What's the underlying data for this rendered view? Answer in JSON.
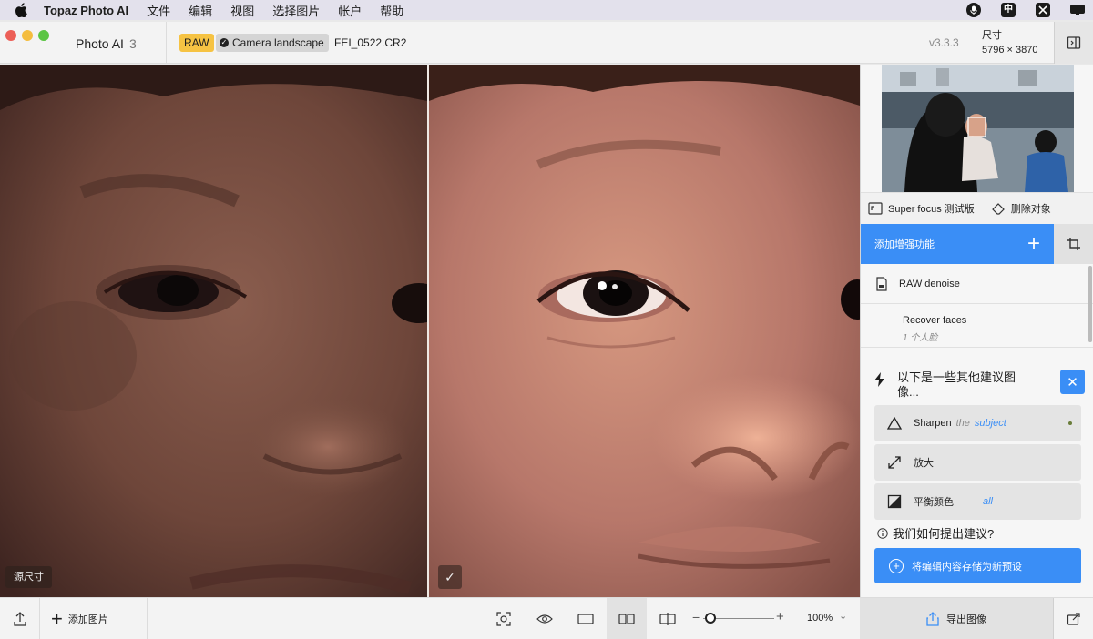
{
  "menubar": {
    "app_name": "Topaz Photo AI",
    "items": [
      "文件",
      "编辑",
      "视图",
      "选择图片",
      "帐户",
      "帮助"
    ],
    "tray_icons": [
      "microphone-icon",
      "input-method-icon",
      "capcut-icon",
      "display-icon"
    ],
    "input_method_label": "中"
  },
  "titlebar": {
    "app_title": "Photo AI",
    "app_version_number": "3",
    "raw_badge": "RAW",
    "preset_badge": "Camera landscape",
    "filename": "FEI_0522.CR2",
    "version": "v3.3.3",
    "size_label": "尺寸",
    "size_value": "5796 × 3870"
  },
  "viewer": {
    "source_label": "源尺寸",
    "check_label": "✓"
  },
  "panel": {
    "tools": [
      {
        "label": "Super focus 测试版",
        "icon": "focus-frame-icon"
      },
      {
        "label": "删除对象",
        "icon": "eraser-icon"
      }
    ],
    "add_enhancement": "添加增强功能",
    "features": [
      {
        "name": "RAW denoise",
        "icon": "raw-file-icon"
      },
      {
        "name": "Recover faces",
        "sub": "1 个人脸"
      }
    ],
    "suggestions_title": "以下是一些其他建议图像...",
    "suggestions": [
      {
        "label": "Sharpen",
        "muted": "the",
        "accent": "subject",
        "icon": "triangle-icon"
      },
      {
        "label": "放大",
        "muted": "",
        "accent": "",
        "icon": "expand-arrow-icon"
      },
      {
        "label": "平衡颜色",
        "muted": "",
        "accent": "all",
        "icon": "color-balance-icon"
      }
    ],
    "how_suggest": "我们如何提出建议?",
    "save_preset": "将编辑内容存储为新预设"
  },
  "bottombar": {
    "add_image": "添加图片",
    "zoom": "100%",
    "zoom_level": 0.1,
    "export": "导出图像"
  },
  "colors": {
    "accent": "#3a8ef6",
    "raw_badge": "#f6c343"
  }
}
